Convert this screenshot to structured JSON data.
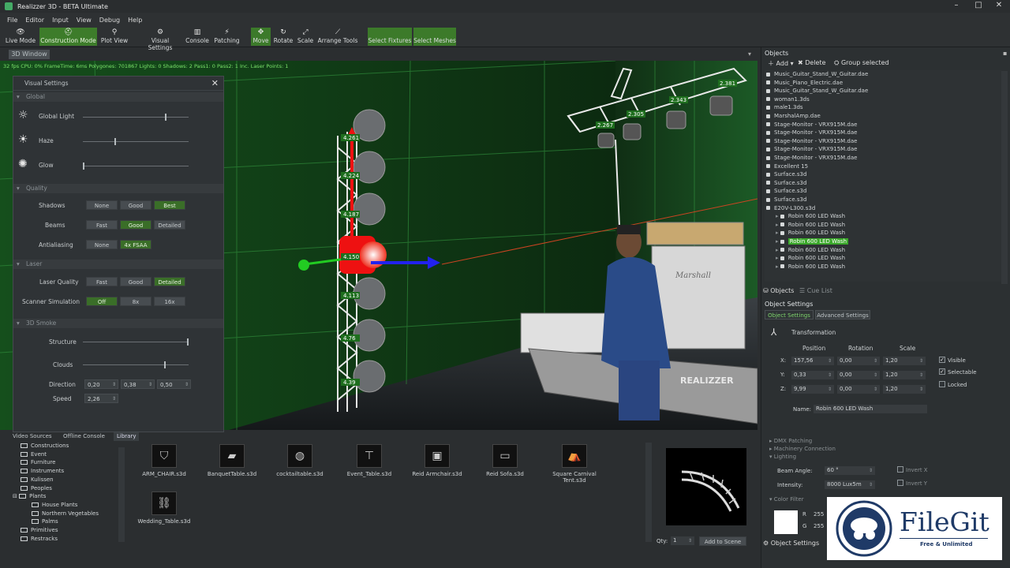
{
  "window": {
    "title": "Realizzer 3D - BETA  Ultimate",
    "controls": [
      "–",
      "□",
      "✕"
    ]
  },
  "menu": [
    "File",
    "Editor",
    "Input",
    "View",
    "Debug",
    "Help"
  ],
  "toolbar": {
    "live_mode": "Live Mode",
    "construction_mode": "Construction Mode",
    "plot_view": "Plot View",
    "visual_settings": "Visual Settings",
    "console": "Console",
    "patching": "Patching",
    "move": "Move",
    "rotate": "Rotate",
    "scale": "Scale",
    "arrange_tools": "Arrange Tools",
    "select_fixtures": "Select Fixtures",
    "select_meshes": "Select Meshes"
  },
  "viewport": {
    "tab": "3D Window",
    "stats": "32 fps  CPU: 0%  FrameTime: 6ms  Polygones: 701867  Lights: 0  Shadows: 2  Pass1: 0  Pass2: 1  Inc. Laser Points: 1",
    "tower_labels": [
      "4.261",
      "4.224",
      "4.187",
      "4.150",
      "4.113",
      "4.76",
      "4.39"
    ],
    "truss_labels": [
      "2.381",
      "2.343",
      "2.305",
      "2.267"
    ],
    "amp_brand": "Marshall",
    "logo": "REALIZZER"
  },
  "visual_settings": {
    "title": "Visual Settings",
    "global": "Global",
    "global_light": "Global Light",
    "haze": "Haze",
    "glow": "Glow",
    "quality": "Quality",
    "shadows": "Shadows",
    "beams": "Beams",
    "antialiasing": "Antialiasing",
    "shadows_opts": [
      "None",
      "Good",
      "Best"
    ],
    "beams_opts": [
      "Fast",
      "Good",
      "Detailed"
    ],
    "aa_opts": [
      "None",
      "4x FSAA"
    ],
    "laser": "Laser",
    "laser_quality": "Laser Quality",
    "laser_quality_opts": [
      "Fast",
      "Good",
      "Detailed"
    ],
    "scanner_sim": "Scanner Simulation",
    "scanner_opts": [
      "Off",
      "8x",
      "16x"
    ],
    "smoke": "3D Smoke",
    "structure": "Structure",
    "clouds": "Clouds",
    "direction": "Direction",
    "speed": "Speed",
    "direction_vals": [
      "0,20",
      "0,38",
      "0,50"
    ],
    "speed_val": "2,26",
    "levels": {
      "global_light": 0.79,
      "haze": 0.3,
      "glow": 0.0,
      "structure": 1.0,
      "clouds": 0.78
    }
  },
  "objects": {
    "title": "Objects",
    "add": "Add",
    "delete": "Delete",
    "group": "Group selected",
    "items": [
      {
        "name": "Music_Guitar_Stand_W_Guitar.dae",
        "depth": 0
      },
      {
        "name": "Music_Piano_Electric.dae",
        "depth": 0
      },
      {
        "name": "Music_Guitar_Stand_W_Guitar.dae",
        "depth": 0
      },
      {
        "name": "woman1.3ds",
        "depth": 0
      },
      {
        "name": "male1.3ds",
        "depth": 0
      },
      {
        "name": "MarshalAmp.dae",
        "depth": 0
      },
      {
        "name": "Stage-Monitor - VRX915M.dae",
        "depth": 0
      },
      {
        "name": "Stage-Monitor - VRX915M.dae",
        "depth": 0
      },
      {
        "name": "Stage-Monitor - VRX915M.dae",
        "depth": 0
      },
      {
        "name": "Stage-Monitor - VRX915M.dae",
        "depth": 0
      },
      {
        "name": "Stage-Monitor - VRX915M.dae",
        "depth": 0
      },
      {
        "name": "Excellent 15",
        "depth": 0
      },
      {
        "name": "Surface.s3d",
        "depth": 0
      },
      {
        "name": "Surface.s3d",
        "depth": 0
      },
      {
        "name": "Surface.s3d",
        "depth": 0
      },
      {
        "name": "Surface.s3d",
        "depth": 0
      },
      {
        "name": "E20V-L300.s3d",
        "depth": 0
      },
      {
        "name": "Robin 600 LED Wash",
        "depth": 1
      },
      {
        "name": "Robin 600 LED Wash",
        "depth": 1
      },
      {
        "name": "Robin 600 LED Wash",
        "depth": 1
      },
      {
        "name": "Robin 600 LED Wash",
        "depth": 1,
        "selected": true
      },
      {
        "name": "Robin 600 LED Wash",
        "depth": 1
      },
      {
        "name": "Robin 600 LED Wash",
        "depth": 1
      },
      {
        "name": "Robin 600 LED Wash",
        "depth": 1
      }
    ],
    "bottom_tab_objects": "Objects",
    "bottom_tab_cue": "Cue List"
  },
  "object_settings": {
    "title": "Object Settings",
    "tab1": "Object Settings",
    "tab2": "Advanced Settings",
    "transformation": "Transformation",
    "col_position": "Position",
    "col_rotation": "Rotation",
    "col_scale": "Scale",
    "rows": [
      {
        "axis": "X:",
        "pos": "157,56",
        "rot": "0,00",
        "scale": "1,20"
      },
      {
        "axis": "Y:",
        "pos": "0,33",
        "rot": "0,00",
        "scale": "1,20"
      },
      {
        "axis": "Z:",
        "pos": "9,99",
        "rot": "0,00",
        "scale": "1,20"
      }
    ],
    "visible": "Visible",
    "selectable": "Selectable",
    "locked": "Locked",
    "name_label": "Name:",
    "name_value": "Robin 600 LED Wash",
    "dmx": "DMX Patching",
    "machinery": "Machinery Connection",
    "lighting": "Lighting",
    "beam_angle": "Beam Angle:",
    "beam_angle_val": "60 °",
    "intensity": "Intensity:",
    "intensity_val": "8000 Lux5m",
    "invert_x": "Invert X",
    "invert_y": "Invert Y",
    "color_filter": "Color Filter",
    "r_label": "R",
    "g_label": "G",
    "r_val": "255",
    "g_val": "255",
    "bottom_tab": "Object Settings"
  },
  "library": {
    "tabs": [
      "Video Sources",
      "Offline Console",
      "Library"
    ],
    "tree": [
      {
        "label": "Constructions",
        "indent": 1
      },
      {
        "label": "Event",
        "indent": 1
      },
      {
        "label": "Furniture",
        "indent": 1
      },
      {
        "label": "Instruments",
        "indent": 1
      },
      {
        "label": "Kulissen",
        "indent": 1
      },
      {
        "label": "Peoples",
        "indent": 1
      },
      {
        "label": "Plants",
        "indent": 1,
        "expanded": true
      },
      {
        "label": "House Plants",
        "indent": 2
      },
      {
        "label": "Northern Vegetables",
        "indent": 2
      },
      {
        "label": "Palms",
        "indent": 2
      },
      {
        "label": "Primitives",
        "indent": 1
      },
      {
        "label": "Restracks",
        "indent": 1
      }
    ],
    "items": [
      "ARM_CHAIR.s3d",
      "BanquetTable.s3d",
      "cocktailtable.s3d",
      "Event_Table.s3d",
      "Reid Armchair.s3d",
      "Reid Sofa.s3d",
      "Square Carnival Tent.s3d",
      "Wedding_Table.s3d"
    ],
    "qty_label": "Qty:",
    "qty_value": "1",
    "add_to_scene": "Add to Scene"
  },
  "watermark": {
    "brand": "FileGit",
    "tagline": "Free & Unlimited"
  },
  "colors": {
    "accent_green": "#3d7c2a",
    "selection_green": "#3aa82a",
    "grid_green": "#2f8a3a"
  }
}
